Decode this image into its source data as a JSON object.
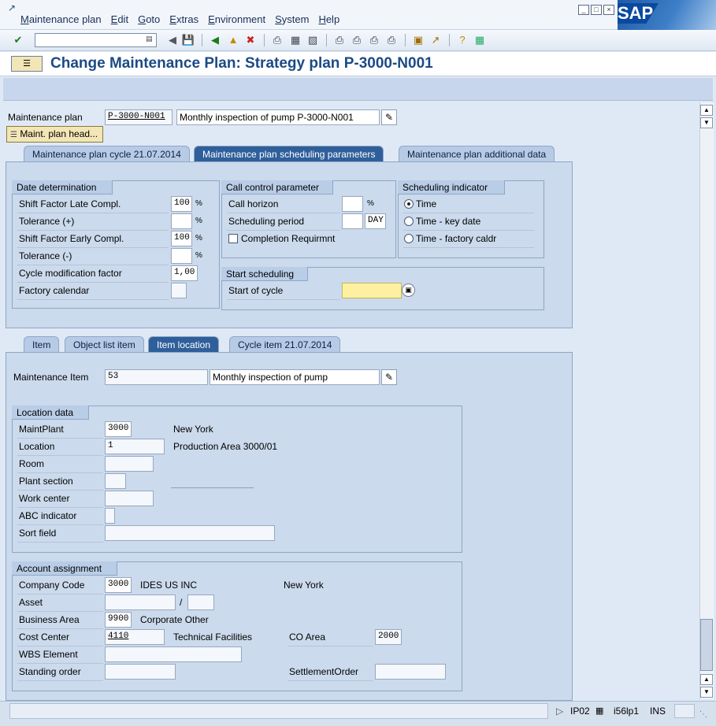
{
  "menu": [
    "Maintenance plan",
    "Edit",
    "Goto",
    "Extras",
    "Environment",
    "System",
    "Help"
  ],
  "window_buttons": [
    "_",
    "□",
    "×"
  ],
  "logo_text": "SAP",
  "toolbar_icons": [
    "check-icon",
    "save-icon",
    "back-icon",
    "exit-icon",
    "cancel-icon",
    "print-icon",
    "find-icon",
    "find-next-icon",
    "first-page-icon",
    "prev-page-icon",
    "next-page-icon",
    "last-page-icon",
    "new-session-icon",
    "shortcut-icon",
    "help-icon",
    "layout-icon"
  ],
  "title": "Change Maintenance Plan: Strategy plan P-3000-N001",
  "header": {
    "plan_label": "Maintenance plan",
    "plan_value": "P-3000-N001",
    "plan_desc": "Monthly inspection of pump P-3000-N001",
    "head_button": "Maint. plan head..."
  },
  "top_tabs": [
    {
      "label": "Maintenance plan cycle 21.07.2014",
      "active": false
    },
    {
      "label": "Maintenance plan scheduling parameters",
      "active": true
    },
    {
      "label": "Maintenance plan additional data",
      "active": false
    }
  ],
  "date_determination": {
    "title": "Date determination",
    "rows": [
      {
        "label": "Shift Factor Late Compl.",
        "value": "100",
        "unit": "%"
      },
      {
        "label": "Tolerance (+)",
        "value": "",
        "unit": "%"
      },
      {
        "label": "Shift Factor Early Compl.",
        "value": "100",
        "unit": "%"
      },
      {
        "label": "Tolerance (-)",
        "value": "",
        "unit": "%"
      },
      {
        "label": "Cycle modification factor",
        "value": "1,00",
        "unit": ""
      },
      {
        "label": "Factory calendar",
        "value": "",
        "unit": ""
      }
    ]
  },
  "call_control": {
    "title": "Call control parameter",
    "call_horizon_label": "Call horizon",
    "call_horizon_value": "",
    "call_horizon_unit": "%",
    "sched_period_label": "Scheduling period",
    "sched_period_value": "",
    "sched_period_unit": "DAY",
    "completion_label": "Completion Requirmnt"
  },
  "sched_indicator": {
    "title": "Scheduling indicator",
    "options": [
      "Time",
      "Time - key date",
      "Time - factory caldr"
    ],
    "selected": "Time"
  },
  "start_sched": {
    "title": "Start scheduling",
    "start_label": "Start of cycle",
    "start_value": ""
  },
  "item_tabs": [
    {
      "label": "Item",
      "active": false
    },
    {
      "label": "Object list item",
      "active": false
    },
    {
      "label": "Item location",
      "active": true
    },
    {
      "label": "Cycle item 21.07.2014",
      "active": false
    }
  ],
  "item": {
    "label": "Maintenance Item",
    "value": "53",
    "desc": "Monthly inspection of pump"
  },
  "location": {
    "title": "Location data",
    "maintplant_label": "MaintPlant",
    "maintplant_value": "3000",
    "maintplant_text": "New York",
    "location_label": "Location",
    "location_value": "1",
    "location_text": "Production Area 3000/01",
    "room_label": "Room",
    "room_value": "",
    "plant_section_label": "Plant section",
    "plant_section_value": "",
    "work_center_label": "Work center",
    "work_center_value": "",
    "abc_label": "ABC indicator",
    "abc_value": "",
    "sort_label": "Sort field",
    "sort_value": ""
  },
  "account": {
    "title": "Account assignment",
    "company_label": "Company Code",
    "company_value": "3000",
    "company_text": "IDES US INC",
    "company_city": "New York",
    "asset_label": "Asset",
    "asset_value": "",
    "asset_sep": "/",
    "asset_sub": "",
    "ba_label": "Business Area",
    "ba_value": "9900",
    "ba_text": "Corporate Other",
    "cc_label": "Cost Center",
    "cc_value": "4110",
    "cc_text": "Technical Facilities",
    "co_area_label": "CO Area",
    "co_area_value": "2000",
    "wbs_label": "WBS Element",
    "wbs_value": "",
    "standing_label": "Standing order",
    "standing_value": "",
    "settlement_label": "SettlementOrder",
    "settlement_value": ""
  },
  "status": {
    "transaction": "IP02",
    "server": "i56lp1",
    "mode": "INS"
  }
}
